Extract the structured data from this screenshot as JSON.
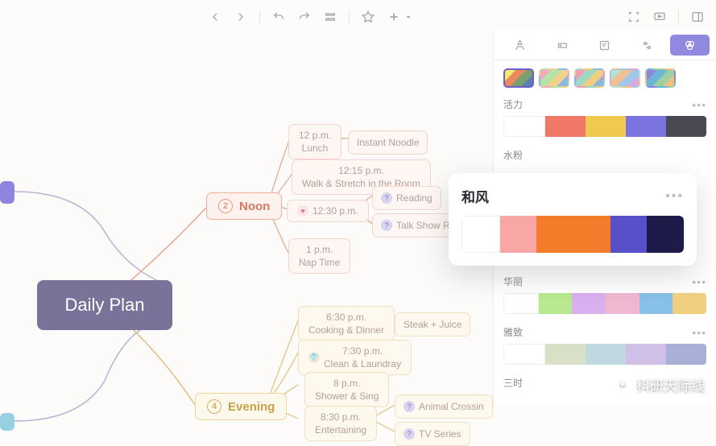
{
  "toolbar": {
    "icons_left": [
      "back",
      "forward",
      "undo",
      "redo",
      "outline",
      "star",
      "plus"
    ],
    "icons_right": [
      "fit",
      "present",
      "sidebar"
    ]
  },
  "panel_tabs": [
    "format",
    "skeleton",
    "notes",
    "relation",
    "style"
  ],
  "mindmap": {
    "root": "Daily Plan",
    "noon": {
      "label": "Noon",
      "num": "2",
      "items": [
        {
          "time": "12 p.m.",
          "text": "Lunch",
          "child": "Instant Noodle"
        },
        {
          "time": "12:15 p.m.",
          "text": "Walk & Stretch in the Room"
        },
        {
          "time": "12:30 p.m.",
          "icon": "heart",
          "children": [
            {
              "icon": "q",
              "text": "Reading"
            },
            {
              "icon": "q",
              "text": "Talk Show Recap"
            }
          ]
        },
        {
          "time": "1 p.m.",
          "text": "Nap Time"
        }
      ]
    },
    "evening": {
      "label": "Evening",
      "num": "4",
      "items": [
        {
          "time": "6:30 p.m.",
          "text": "Cooking & Dinner",
          "child": "Steak + Juice"
        },
        {
          "time": "7:30 p.m.",
          "text": "Clean & Laundray",
          "icon": "shirt"
        },
        {
          "time": "8 p.m.",
          "text": "Shower & Sing"
        },
        {
          "time": "8:30 p.m.",
          "text": "Entertaining",
          "children": [
            {
              "icon": "q",
              "text": "Animal Crossin"
            },
            {
              "icon": "q",
              "text": "TV Series"
            }
          ]
        }
      ]
    }
  },
  "themes": [
    {
      "g": [
        "#f7e96b",
        "#e88a5e",
        "#7a9f6e",
        "#5b7fb5"
      ]
    },
    {
      "g": [
        "#f3a9c0",
        "#b6e3a8",
        "#f0d38a",
        "#8fb8e0"
      ]
    },
    {
      "g": [
        "#f0a0b5",
        "#a0d8c5",
        "#f0d080",
        "#90b5dd"
      ]
    },
    {
      "g": [
        "#b5e0d5",
        "#f0c090",
        "#a0c8e8",
        "#d8a8e0"
      ]
    },
    {
      "g": [
        "#8f85e0",
        "#6bb5d8",
        "#9fd0a0",
        "#f0c080"
      ]
    }
  ],
  "palettes": [
    {
      "name": "活力",
      "colors": [
        "#ffffff",
        "#f07868",
        "#f1c94f",
        "#7a73e0",
        "#4a4850"
      ]
    },
    {
      "name": "水粉",
      "colors": []
    },
    {
      "name": "华丽",
      "colors": [
        "#ffffff",
        "#b8e88f",
        "#d8b0f0",
        "#f0b8d0",
        "#88c0e8",
        "#f0d080"
      ]
    },
    {
      "name": "雅致",
      "colors": [
        "#ffffff",
        "#d8e0c8",
        "#c0d8e0",
        "#d0c0e8",
        "#a8b0d8"
      ]
    },
    {
      "name": "三时",
      "colors": [
        "#ffffff",
        "#f0a890",
        "#c0e0d0",
        "#b0c8e0"
      ]
    }
  ],
  "popup": {
    "name": "和风",
    "colors": [
      "#ffffff",
      "#f9a6a6",
      "#f27c2a",
      "#f27c2a",
      "#5850c9",
      "#1e1a4a"
    ]
  },
  "more": "•••",
  "watermark": "科研天际线"
}
